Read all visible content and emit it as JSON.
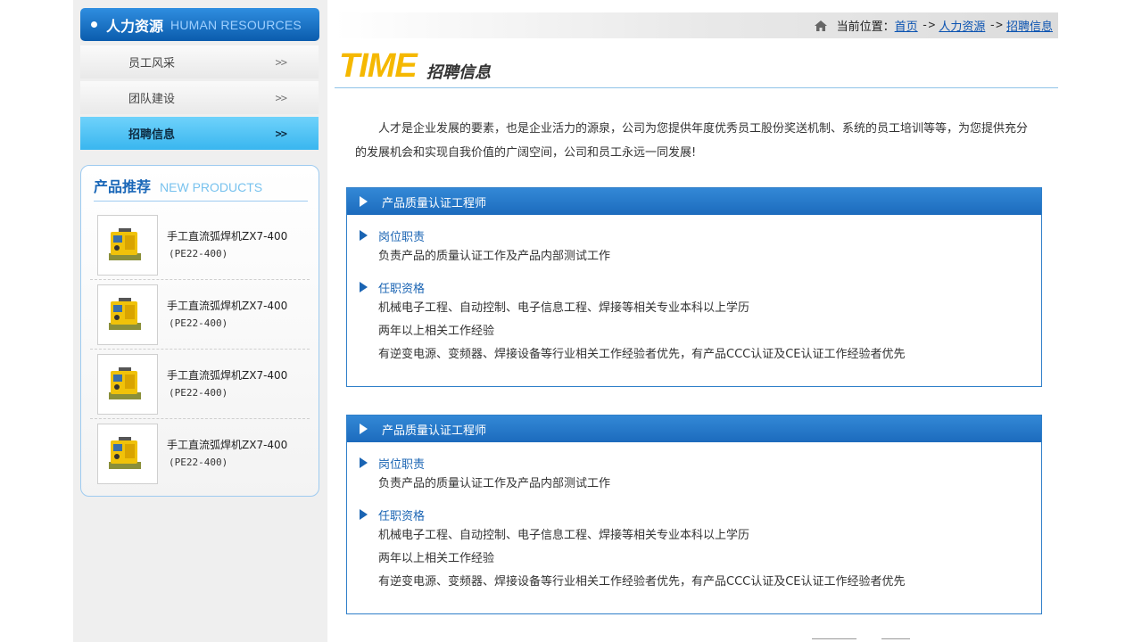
{
  "sidebar": {
    "header": {
      "title_zh": "人力资源",
      "title_en": "HUMAN RESOURCES"
    },
    "nav": [
      {
        "label": "员工风采",
        "arrow": ">>"
      },
      {
        "label": "团队建设",
        "arrow": ">>"
      },
      {
        "label": "招聘信息",
        "arrow": ">>",
        "active": true
      }
    ],
    "products": {
      "title_zh": "产品推荐",
      "title_en": "NEW PRODUCTS",
      "items": [
        {
          "name": "手工直流弧焊机ZX7-400",
          "model": "(PE22-400)"
        },
        {
          "name": "手工直流弧焊机ZX7-400",
          "model": "(PE22-400)"
        },
        {
          "name": "手工直流弧焊机ZX7-400",
          "model": "(PE22-400)"
        },
        {
          "name": "手工直流弧焊机ZX7-400",
          "model": "(PE22-400)"
        }
      ]
    }
  },
  "breadcrumb": {
    "prefix": "当前位置：",
    "items": [
      "首页",
      "人力资源",
      "招聘信息"
    ],
    "separator": "->",
    "icon": "home-icon"
  },
  "page_title": {
    "en": "TIME",
    "zh": "招聘信息"
  },
  "intro": "人才是企业发展的要素，也是企业活力的源泉，公司为您提供年度优秀员工股份奖送机制、系统的员工培训等等，为您提供充分的发展机会和实现自我价值的广阔空间，公司和员工永远一同发展!",
  "jobs": [
    {
      "title": "产品质量认证工程师",
      "duty_title": "岗位职责",
      "duties": [
        "负责产品的质量认证工作及产品内部测试工作"
      ],
      "req_title": "任职资格",
      "requirements": [
        "机械电子工程、自动控制、电子信息工程、焊接等相关专业本科以上学历",
        "两年以上相关工作经验",
        "有逆变电源、变频器、焊接设备等行业相关工作经验者优先，有产品CCC认证及CE认证工作经验者优先"
      ]
    },
    {
      "title": "产品质量认证工程师",
      "duty_title": "岗位职责",
      "duties": [
        "负责产品的质量认证工作及产品内部测试工作"
      ],
      "req_title": "任职资格",
      "requirements": [
        "机械电子工程、自动控制、电子信息工程、焊接等相关专业本科以上学历",
        "两年以上相关工作经验",
        "有逆变电源、变频器、焊接设备等行业相关工作经验者优先，有产品CCC认证及CE认证工作经验者优先"
      ]
    }
  ],
  "colors": {
    "brand_blue": "#1c6bbd",
    "active_nav": "#39b6ef",
    "title_yellow": "#f5b800",
    "link": "#0b53b1"
  }
}
